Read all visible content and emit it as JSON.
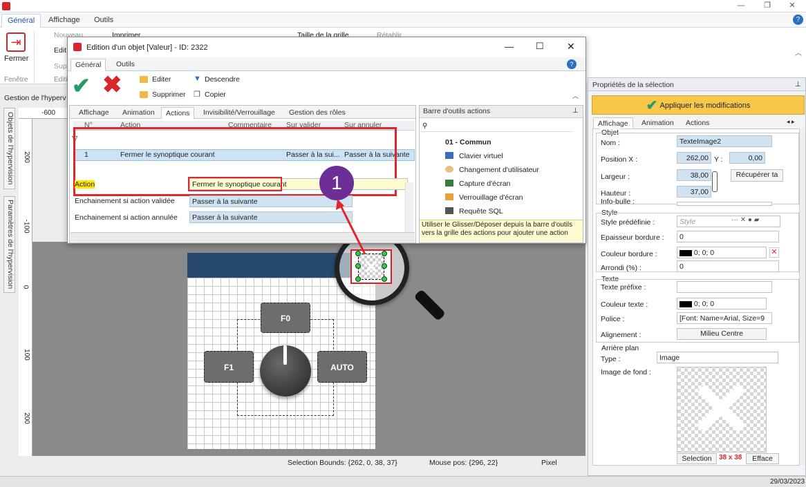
{
  "window": {
    "title_icon": "app-icon",
    "help": "?"
  },
  "menu": {
    "tabs": [
      "Général",
      "Affichage",
      "Outils"
    ]
  },
  "ribbon": {
    "close_label": "Fermer",
    "window_group": "Fenêtre",
    "edit_group": "Editi",
    "new": "Nouveau",
    "edit": "Edit",
    "delete": "Sup",
    "print": "Imprimer",
    "grid_size": "Taille de la grille",
    "restore": "Rétablir"
  },
  "left_tabs": {
    "objects": "Objets de l'hypervision",
    "params": "Paramètres de l'hypervision"
  },
  "hyper_header": "Gestion de l'hyperv",
  "ruler": {
    "top": "-600",
    "marks": [
      "200",
      "-100",
      "0",
      "100",
      "200"
    ]
  },
  "dialog": {
    "title": "Edition d'un objet [Valeur] - ID: 2322",
    "tabs": [
      "Général",
      "Outils"
    ],
    "toolbar": {
      "edit": "Editer",
      "delete": "Supprimer",
      "down": "Descendre",
      "copy": "Copier"
    },
    "subtabs": [
      "Affichage",
      "Animation",
      "Actions",
      "Invisibilité/Verrouillage",
      "Gestion des rôles"
    ],
    "grid_headers": [
      "N°",
      "Action",
      "Commentaire",
      "Sur valider",
      "Sur annuler"
    ],
    "row": {
      "num": "1",
      "action": "Fermer le synoptique courant",
      "on_validate": "Passer à la sui...",
      "on_cancel": "Passer à la suivante"
    },
    "fields": {
      "action_label": "Action",
      "action_value": "Fermer le synoptique courant",
      "on_valid_label": "Enchainement si action validée",
      "on_valid_value": "Passer à la suivante",
      "on_cancel_label": "Enchainement si action annulée",
      "on_cancel_value": "Passer à la suivante"
    },
    "toolbox": {
      "title": "Barre d'outils actions",
      "category": "01 - Commun",
      "items": [
        "Clavier virtuel",
        "Changement d'utilisateur",
        "Capture d'écran",
        "Verrouillage d'écran",
        "Requête SQL"
      ],
      "hint": "Utiliser le Glisser/Déposer depuis la barre d'outils vers la grille des actions pour ajouter une action"
    }
  },
  "callout": {
    "number": "1"
  },
  "synoptic": {
    "buttons": {
      "f0": "F0",
      "f1": "F1",
      "auto": "AUTO"
    }
  },
  "props": {
    "title": "Propriétés de la sélection",
    "apply": "Appliquer les modifications",
    "tabs": [
      "Affichage",
      "Animation",
      "Actions"
    ],
    "objet_group": "Objet",
    "nom_label": "Nom :",
    "nom": "TexteImage2",
    "posx_label": "Position X :",
    "posx": "262,00",
    "posy_label": "Y :",
    "posy": "0,00",
    "largeur_label": "Largeur :",
    "largeur": "38,00",
    "recuperer": "Récupérer ta",
    "hauteur_label": "Hauteur :",
    "hauteur": "37,00",
    "infobulle_label": "Info-bulle :",
    "style_group": "Style",
    "style_predef_label": "Style prédéfinie :",
    "style_predef": "Style",
    "epaisseur_label": "Epaisseur bordure :",
    "epaisseur": "0",
    "couleur_bordure_label": "Couleur bordure :",
    "couleur_bordure": "0; 0; 0",
    "arrondi_label": "Arrondi (%) :",
    "arrondi": "0",
    "texte_group": "Texte",
    "texte_prefixe_label": "Texte préfixe :",
    "couleur_texte_label": "Couleur texte :",
    "couleur_texte": "0; 0; 0",
    "police_label": "Police :",
    "police": "[Font: Name=Arial, Size=9",
    "alignement_label": "Alignement :",
    "alignement": "Milieu Centre",
    "arriere_group": "Arrière plan",
    "type_label": "Type :",
    "type": "Image",
    "image_fond_label": "Image de fond :",
    "selection_btn": "Selection",
    "size_badge": "38 x 38",
    "effacer_btn": "Efface"
  },
  "status": {
    "bounds": "Selection Bounds: {262, 0, 38, 37}",
    "mouse": "Mouse pos: {296, 22}",
    "unit": "Pixel",
    "date": "29/03/2023"
  },
  "colors": {
    "accent_red": "#d9262c",
    "check_green": "#2a9a6b",
    "apply_bg": "#f6c74a",
    "callout": "#6b2f96"
  }
}
